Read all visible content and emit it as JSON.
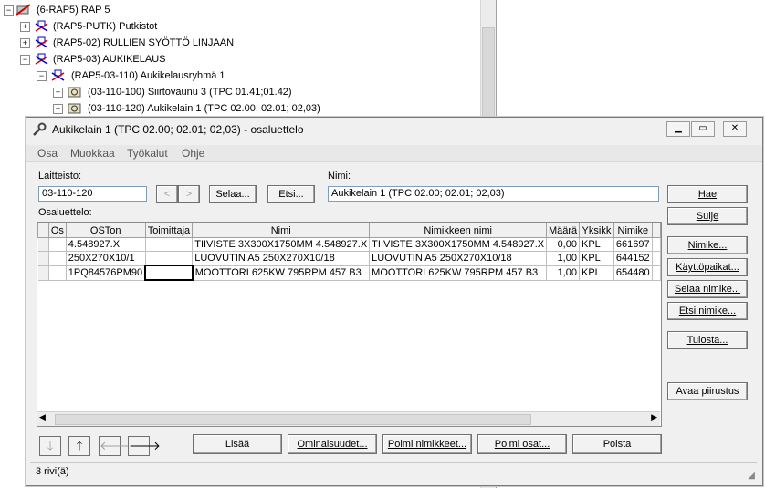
{
  "tree": {
    "items": [
      {
        "label": "(6-RAP5)  RAP 5",
        "expander": "−",
        "icon": "root-icon"
      },
      {
        "label": "(RAP5-PUTK)  Putkistot",
        "expander": "+",
        "icon": "assembly-icon"
      },
      {
        "label": "(RAP5-02)  RULLIEN SYÖTTÖ LINJAAN",
        "expander": "+",
        "icon": "assembly-icon"
      },
      {
        "label": "(RAP5-03)  AUKIKELAUS",
        "expander": "−",
        "icon": "assembly-icon"
      },
      {
        "label": "(RAP5-03-110)  Aukikelausryhmä 1",
        "expander": "−",
        "icon": "assembly-icon"
      },
      {
        "label": "(03-110-100)  Siirtovaunu 3 (TPC 01.41;01.42)",
        "expander": "+",
        "icon": "machine-icon"
      },
      {
        "label": "(03-110-120)  Aukikelain 1 (TPC 02.00; 02.01; 02,03)",
        "expander": "+",
        "icon": "machine-icon"
      }
    ]
  },
  "dialog": {
    "title": "Aukikelain 1 (TPC 02.00; 02.01; 02,03) - osaluettelo",
    "menu": [
      "Osa",
      "Muokkaa",
      "Työkalut",
      "Ohje"
    ],
    "laitteisto_label": "Laitteisto:",
    "laitteisto_value": "03-110-120",
    "prev_label": "<",
    "next_label": ">",
    "selaa_label": "Selaa...",
    "etsi_label": "Etsi...",
    "nimi_label": "Nimi:",
    "nimi_value": "Aukikelain 1 (TPC 02.00; 02.01; 02,03)",
    "osaluettelo_label": "Osaluettelo:",
    "columns": [
      "",
      "Os",
      "OSTon",
      "Toimittaja",
      "Nimi",
      "Nimikkeen nimi",
      "Määrä",
      "Yksikk",
      "Nimike",
      ""
    ],
    "rows": [
      [
        "",
        "",
        "4.548927.X",
        "",
        "TIIVISTE 3X300X1750MM 4.548927.X",
        "TIIVISTE 3X300X1750MM 4.548927.X",
        "0,00",
        "KPL",
        "661697",
        ""
      ],
      [
        "",
        "",
        "250X270X10/1",
        "",
        "LUOVUTIN A5 250X270X10/18",
        "LUOVUTIN A5 250X270X10/18",
        "1,00",
        "KPL",
        "644152",
        ""
      ],
      [
        "",
        "",
        "1PQ84576PM90",
        "",
        "MOOTTORI 625KW 795RPM 457 B3",
        "MOOTTORI 625KW 795RPM 457 B3",
        "1,00",
        "KPL",
        "654480",
        ""
      ]
    ],
    "side_buttons": {
      "hae": "Hae",
      "sulje": "Sulje",
      "nimike": "Nimike...",
      "kayttopaikat": "Käyttöpaikat...",
      "selaa_nimike": "Selaa nimike...",
      "etsi_nimike": "Etsi nimike...",
      "tulosta": "Tulosta...",
      "avaa_piirustus": "Avaa piirustus"
    },
    "bottom_buttons": {
      "lisaa": "Lisää",
      "ominaisuudet": "Ominaisuudet...",
      "poimi_nimikkeet": "Poimi nimikkeet...",
      "poimi_osat": "Poimi osat...",
      "poista": "Poista"
    },
    "arrows": {
      "down": "🡓",
      "up": "🡑",
      "left": "🡐",
      "right": "🡒"
    },
    "status": "3 rivi(ä)"
  }
}
